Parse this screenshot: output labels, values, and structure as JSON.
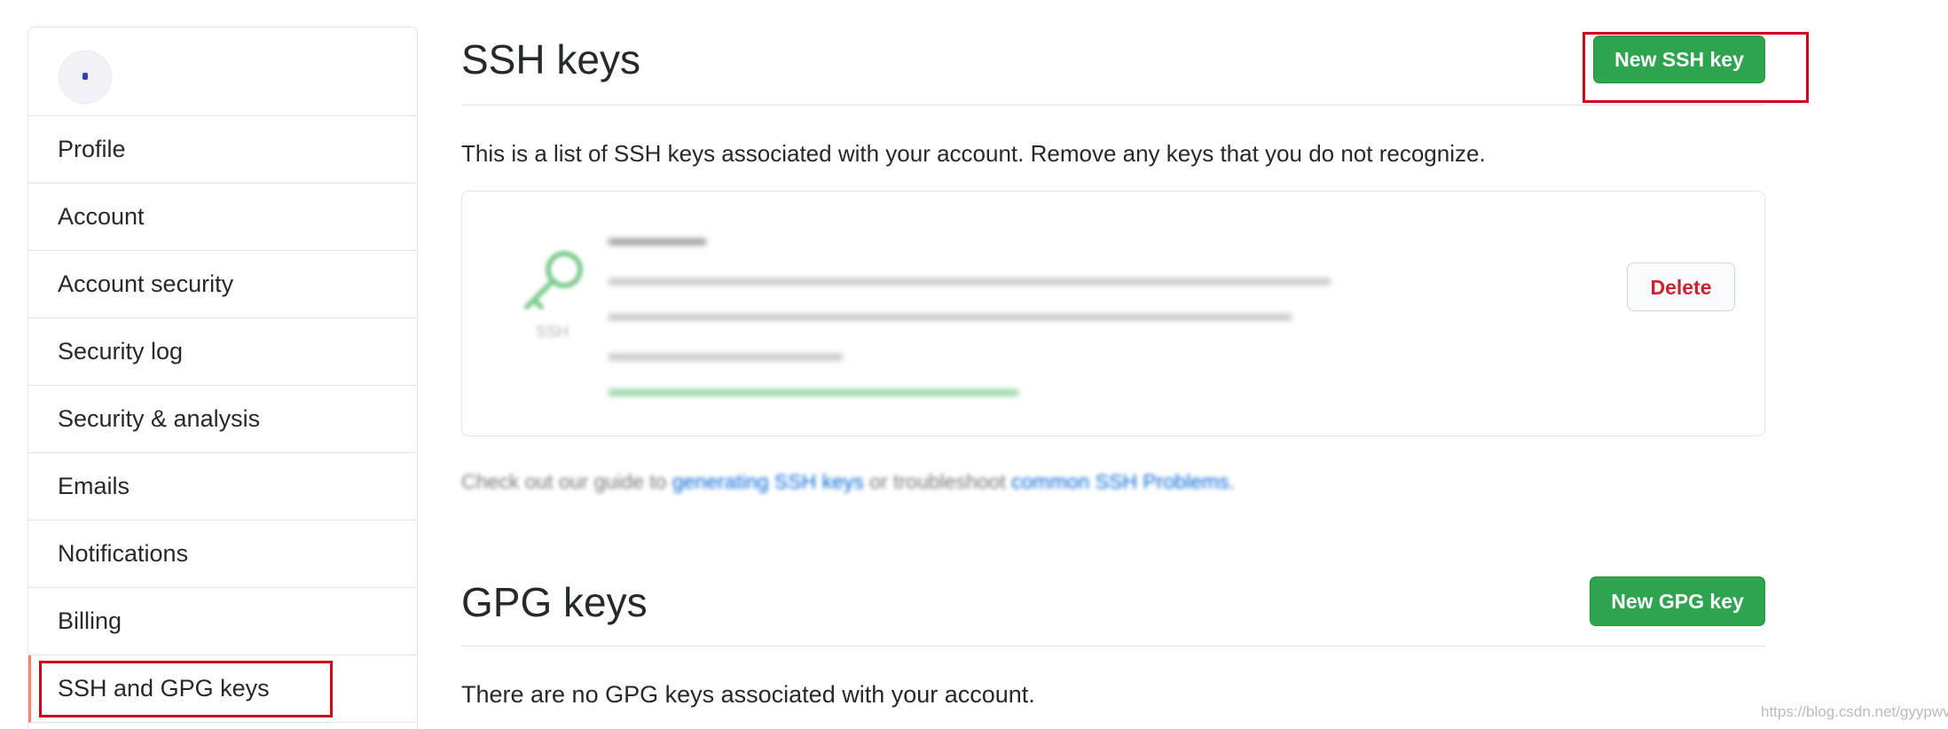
{
  "sidebar": {
    "user": {
      "name": "",
      "subtitle": ""
    },
    "items": [
      {
        "label": "Profile"
      },
      {
        "label": "Account"
      },
      {
        "label": "Account security"
      },
      {
        "label": "Security log"
      },
      {
        "label": "Security & analysis"
      },
      {
        "label": "Emails"
      },
      {
        "label": "Notifications"
      },
      {
        "label": "Billing"
      },
      {
        "label": "SSH and GPG keys",
        "selected": true
      }
    ]
  },
  "ssh": {
    "title": "SSH keys",
    "new_button": "New SSH key",
    "description": "This is a list of SSH keys associated with your account. Remove any keys that you do not recognize.",
    "key": {
      "type_label": "SSH",
      "delete_button": "Delete"
    },
    "guide": {
      "prefix": "Check out our guide to",
      "link1": "generating SSH keys",
      "middle": "or troubleshoot",
      "link2": "common SSH Problems."
    }
  },
  "gpg": {
    "title": "GPG keys",
    "new_button": "New GPG key",
    "empty_text": "There are no GPG keys associated with your account."
  },
  "watermark": "https://blog.csdn.net/gyypwv",
  "colors": {
    "primary_button": "#2ea44f",
    "danger_text": "#cb2431",
    "selected_accent": "#f9826c",
    "highlight_box": "#d0021b",
    "link": "#0366d6"
  }
}
